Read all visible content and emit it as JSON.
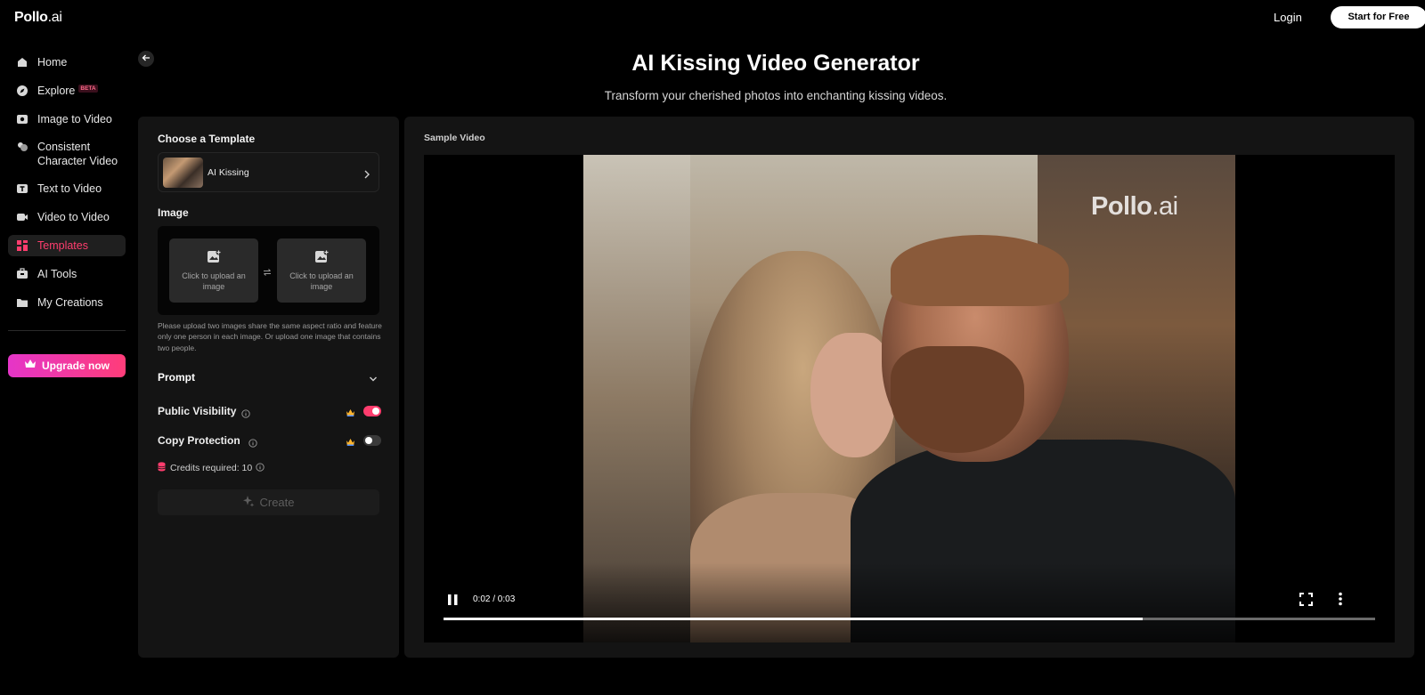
{
  "app": {
    "logo_main": "Pollo",
    "logo_suffix": ".ai"
  },
  "header": {
    "login_label": "Login",
    "start_label": "Start for Free"
  },
  "sidebar": {
    "items": [
      {
        "label": "Home",
        "icon": "home-icon"
      },
      {
        "label": "Explore",
        "badge": "BETA",
        "icon": "compass-icon"
      },
      {
        "label": "Image to Video",
        "icon": "image-video-icon"
      },
      {
        "label": "Consistent Character Video",
        "icon": "character-icon"
      },
      {
        "label": "Text to Video",
        "icon": "text-video-icon"
      },
      {
        "label": "Video to Video",
        "icon": "video-camera-icon"
      },
      {
        "label": "Templates",
        "icon": "templates-icon",
        "active": true
      },
      {
        "label": "AI Tools",
        "icon": "toolbox-icon"
      },
      {
        "label": "My Creations",
        "icon": "folder-icon"
      }
    ],
    "upgrade_label": "Upgrade now"
  },
  "hero": {
    "title": "AI Kissing Video Generator",
    "subtitle": "Transform your cherished photos into enchanting kissing videos."
  },
  "form": {
    "template_heading": "Choose a Template",
    "template_name": "AI Kissing",
    "image_heading": "Image",
    "upload_text_1": "Click to upload an image",
    "upload_text_2": "Click to upload an image",
    "hint": "Please upload two images share the same aspect ratio and feature only one person in each image. Or upload one image that contains two people.",
    "prompt_label": "Prompt",
    "public_visibility_label": "Public Visibility",
    "public_visibility_on": true,
    "copy_protection_label": "Copy Protection",
    "copy_protection_on": false,
    "credits_label": "Credits required: 10",
    "create_label": "Create"
  },
  "sample": {
    "label": "Sample Video",
    "watermark_main": "Pollo",
    "watermark_suffix": ".ai",
    "time": "0:02 / 0:03",
    "progress": 0.75
  },
  "colors": {
    "accent": "#ff3d6e",
    "upgrade_gradient_start": "#e535c8",
    "upgrade_gradient_end": "#ff3d79",
    "panel": "#141414"
  }
}
